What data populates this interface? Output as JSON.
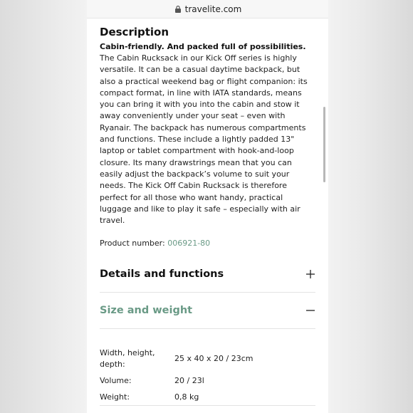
{
  "browser": {
    "url": "travelite.com",
    "lock_icon": "lock-icon"
  },
  "description": {
    "heading": "Description",
    "subtitle": "Cabin-friendly. And packed full of possibilities.",
    "paragraph": "The Cabin Rucksack in our Kick Off series is highly versatile. It can be a casual daytime backpack, but also a practical weekend bag or flight companion: its compact format, in line with IATA standards, means you can bring it with you into the cabin and stow it away conveniently under your seat – even with Ryanair. The backpack has numerous compartments and functions. These include a lightly padded 13\" laptop or tablet compartment with hook-and-loop closure. Its many drawstrings mean that you can easily adjust the backpack’s volume to suit your needs. The Kick Off Cabin Rucksack is therefore perfect for all those who want handy, practical luggage and like to play it safe – especially with air travel.",
    "product_number_label": "Product number:",
    "product_number_value": "006921-80"
  },
  "accordions": [
    {
      "title": "Details and functions",
      "icon": "plus-icon",
      "expanded": false
    },
    {
      "title": "Size and weight",
      "icon": "minus-icon",
      "expanded": true
    }
  ],
  "specs": [
    {
      "label": "Width, height, depth:",
      "value": "25 x 40 x 20 /  23cm"
    },
    {
      "label": "Volume:",
      "value": "20 /  23l"
    },
    {
      "label": "Weight:",
      "value": "0,8 kg"
    }
  ],
  "colors": {
    "accent_green": "#6a9a86",
    "text": "#222222",
    "page_background": "#ffffff"
  }
}
